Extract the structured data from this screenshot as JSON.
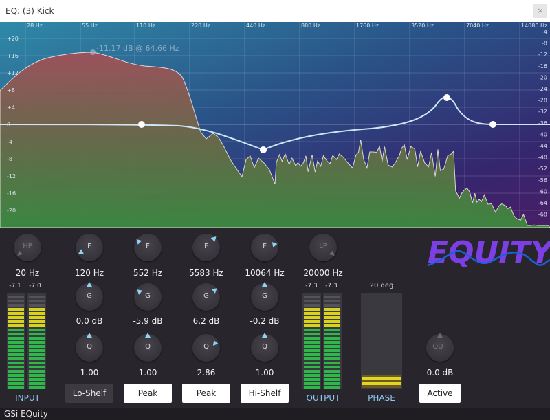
{
  "window": {
    "title": "EQ: (3) Kick",
    "close_label": "×"
  },
  "graph": {
    "freq_labels": [
      "28 Hz",
      "55 Hz",
      "110 Hz",
      "220 Hz",
      "440 Hz",
      "880 Hz",
      "1760 Hz",
      "3520 Hz",
      "7040 Hz",
      "14080 Hz"
    ],
    "left_db_labels": [
      "+20",
      "+16",
      "+12",
      "+8",
      "+4",
      "0",
      "-4",
      "-8",
      "-12",
      "-16",
      "-20"
    ],
    "right_db_labels": [
      "-4",
      "-8",
      "-12",
      "-16",
      "-20",
      "-24",
      "-28",
      "-32",
      "-36",
      "-40",
      "-44",
      "-48",
      "-52",
      "-56",
      "-60",
      "-64",
      "-68"
    ],
    "peak_readout": "-11.17 dB @ 64.66 Hz"
  },
  "input": {
    "meter_left": "-7.1",
    "meter_right": "-7.0",
    "label": "INPUT"
  },
  "hp": {
    "knob": "HP",
    "value": "20 Hz"
  },
  "bands": [
    {
      "f": "F",
      "freq": "120 Hz",
      "g": "G",
      "gain": "0.0 dB",
      "q": "Q",
      "q_val": "1.00",
      "type": "Lo-Shelf"
    },
    {
      "f": "F",
      "freq": "552 Hz",
      "g": "G",
      "gain": "-5.9 dB",
      "q": "Q",
      "q_val": "1.00",
      "type": "Peak"
    },
    {
      "f": "F",
      "freq": "5583 Hz",
      "g": "G",
      "gain": "6.2 dB",
      "q": "Q",
      "q_val": "2.86",
      "type": "Peak"
    },
    {
      "f": "F",
      "freq": "10064 Hz",
      "g": "G",
      "gain": "-0.2 dB",
      "q": "Q",
      "q_val": "1.00",
      "type": "Hi-Shelf"
    }
  ],
  "lp": {
    "knob": "LP",
    "value": "20000 Hz"
  },
  "output": {
    "meter_left": "-7.3",
    "meter_right": "-7.3",
    "label": "OUTPUT"
  },
  "phase": {
    "value": "20 deg",
    "label": "PHASE"
  },
  "out": {
    "knob": "OUT",
    "value": "0.0 dB",
    "state": "Active"
  },
  "logo": {
    "text": "EQUITY"
  },
  "status": {
    "text": "GSi EQuity"
  },
  "colors": {
    "accent": "#8ec8f0",
    "meter_green": "#2fb84a",
    "meter_yellow": "#d9d21a",
    "logo_purple": "#7b3fe4"
  }
}
